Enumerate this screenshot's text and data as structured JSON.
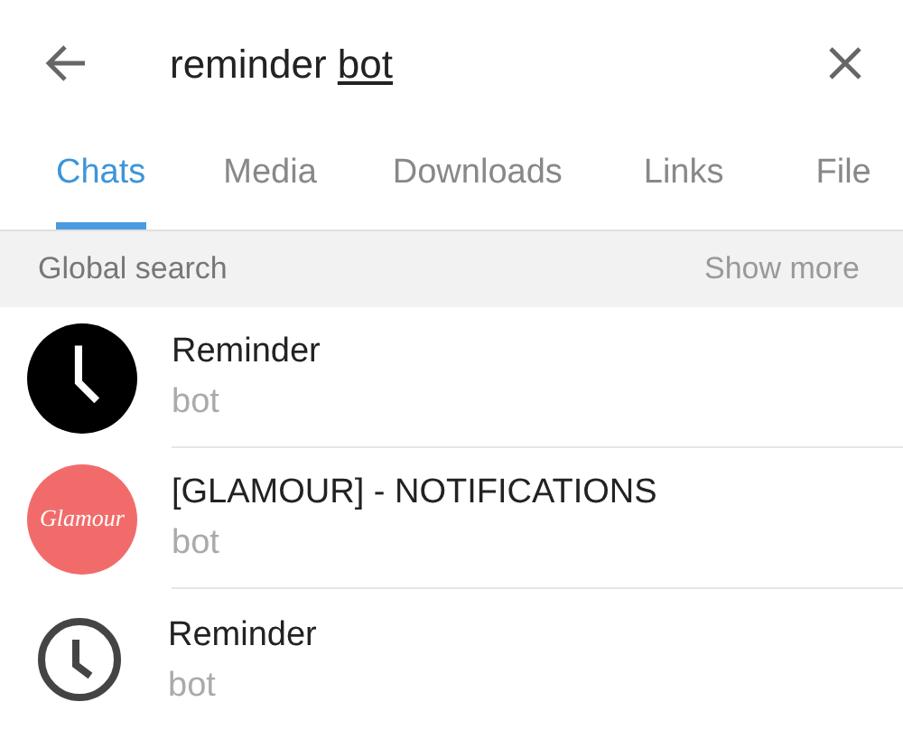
{
  "search": {
    "value": "reminder",
    "composing": "bot"
  },
  "tabs": [
    {
      "label": "Chats",
      "selected": true
    },
    {
      "label": "Media",
      "selected": false
    },
    {
      "label": "Downloads",
      "selected": false
    },
    {
      "label": "Links",
      "selected": false
    },
    {
      "label": "File",
      "selected": false
    }
  ],
  "section": {
    "title": "Global search",
    "action": "Show more"
  },
  "results": [
    {
      "avatar": {
        "kind": "clock_filled"
      },
      "name": "Reminder",
      "subtitle": "bot"
    },
    {
      "avatar": {
        "kind": "logo",
        "text": "Glamour"
      },
      "name": "[GLAMOUR] - NOTIFICATIONS",
      "subtitle": "bot"
    },
    {
      "avatar": {
        "kind": "clock_outline"
      },
      "name": "Reminder",
      "subtitle": "bot"
    }
  ]
}
